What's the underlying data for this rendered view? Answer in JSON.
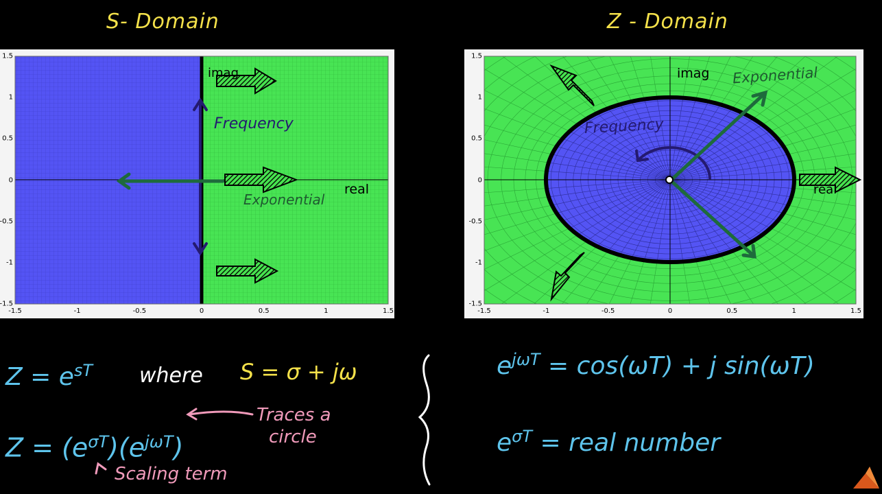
{
  "titles": {
    "s": "S- Domain",
    "z": "Z - Domain"
  },
  "colors": {
    "stable": "#5454f4",
    "unstable": "#48e454",
    "arrow": "#1e6a3c",
    "yellow": "#f4e14a",
    "cyan": "#5ec4ec",
    "pink": "#f09aba",
    "white": "#ffffff"
  },
  "s_plot": {
    "x_ticks": [
      "-1.5",
      "-1",
      "-0.5",
      "0",
      "0.5",
      "1",
      "1.5"
    ],
    "y_ticks": [
      "1.5",
      "1",
      "0.5",
      "0",
      "-0.5",
      "-1",
      "-1.5"
    ],
    "axis_labels": {
      "imag": "imag",
      "real": "real"
    },
    "annotations": {
      "frequency": "Frequency",
      "exponential": "Exponential"
    }
  },
  "z_plot": {
    "x_ticks": [
      "-1.5",
      "-1",
      "-0.5",
      "0",
      "0.5",
      "1",
      "1.5"
    ],
    "y_ticks": [
      "1.5",
      "1",
      "0.5",
      "0",
      "-0.5",
      "-1",
      "-1.5"
    ],
    "axis_labels": {
      "imag": "imag",
      "real": "real"
    },
    "annotations": {
      "frequency": "Frequency",
      "exponential": "Exponential"
    }
  },
  "equations": {
    "z_def": {
      "lhs": "Z = e",
      "sup": "sT"
    },
    "where": "where",
    "s_def": "S = σ + jω",
    "z_split": {
      "lhs": "Z = (e",
      "sup1": "σT",
      "mid": ")(e",
      "sup2": "jωT",
      "end": ")"
    },
    "traces": [
      "Traces a",
      "circle"
    ],
    "scaling": "Scaling term",
    "euler": {
      "base": "e",
      "sup": "jωT",
      "rhs": "= cos(ωT) + j sin(ωT)"
    },
    "real_num": {
      "base": "e",
      "sup": "σT",
      "rhs": "= real number"
    }
  }
}
